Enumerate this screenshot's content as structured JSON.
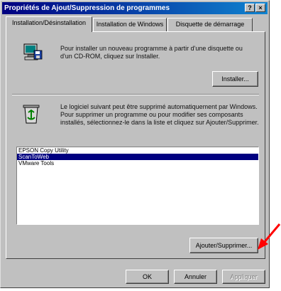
{
  "window": {
    "title": "Propriétés de Ajout/Suppression de programmes",
    "help_label": "?",
    "close_label": "×"
  },
  "tabs": [
    {
      "label": "Installation/Désinstallation"
    },
    {
      "label": "Installation de Windows"
    },
    {
      "label": "Disquette de démarrage"
    }
  ],
  "install_section": {
    "text": "Pour installer un nouveau programme à partir d'une disquette ou d'un CD-ROM, cliquez sur Installer.",
    "button_label": "Installer..."
  },
  "remove_section": {
    "text": "Le logiciel suivant peut être supprimé automatiquement par Windows. Pour supprimer un programme ou pour modifier ses composants installés, sélectionnez-le dans la liste et cliquez sur Ajouter/Supprimer."
  },
  "programs": [
    {
      "name": "EPSON Copy Utility",
      "selected": false
    },
    {
      "name": "ScanToWeb",
      "selected": true
    },
    {
      "name": "VMware Tools",
      "selected": false
    }
  ],
  "add_remove_button": "Ajouter/Supprimer...",
  "footer": {
    "ok": "OK",
    "cancel": "Annuler",
    "apply": "Appliquer"
  },
  "colors": {
    "titlebar_start": "#000080",
    "titlebar_end": "#1084d0",
    "selection": "#000080",
    "annotation_arrow": "#ff0000"
  }
}
